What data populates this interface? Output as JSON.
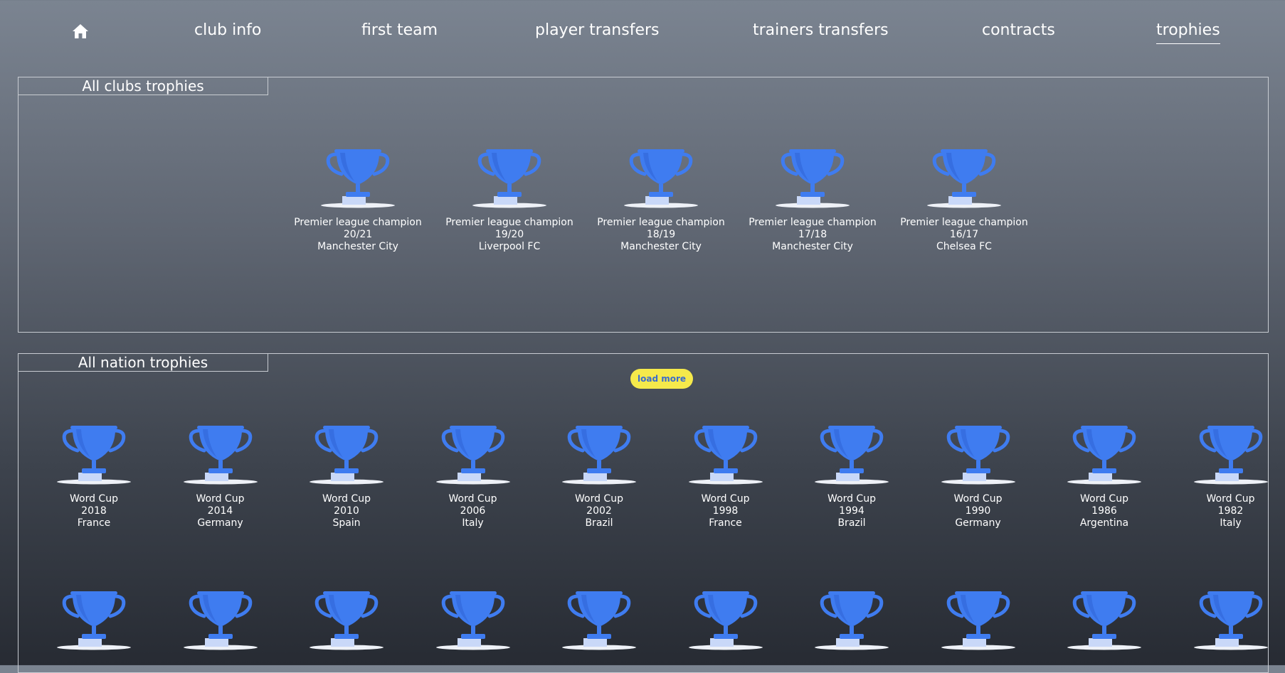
{
  "nav": {
    "items": [
      {
        "label": "club info"
      },
      {
        "label": "first team"
      },
      {
        "label": "player transfers"
      },
      {
        "label": "trainers transfers"
      },
      {
        "label": "contracts"
      },
      {
        "label": "trophies"
      }
    ],
    "active": "trophies"
  },
  "clubs": {
    "title": "All clubs trophies",
    "load_more": "load more",
    "trophies": [
      {
        "name": "Premier league champion",
        "season": "20/21",
        "winner": "Manchester City"
      },
      {
        "name": "Premier league champion",
        "season": "19/20",
        "winner": "Liverpool FC"
      },
      {
        "name": "Premier league champion",
        "season": "18/19",
        "winner": "Manchester City"
      },
      {
        "name": "Premier league champion",
        "season": "17/18",
        "winner": "Manchester City"
      },
      {
        "name": "Premier league champion",
        "season": "16/17",
        "winner": "Chelsea FC"
      }
    ]
  },
  "nations": {
    "title": "All nation trophies",
    "trophies": [
      {
        "name": "Word Cup",
        "year": "2018",
        "winner": "France"
      },
      {
        "name": "Word Cup",
        "year": "2014",
        "winner": "Germany"
      },
      {
        "name": "Word Cup",
        "year": "2010",
        "winner": "Spain"
      },
      {
        "name": "Word Cup",
        "year": "2006",
        "winner": "Italy"
      },
      {
        "name": "Word Cup",
        "year": "2002",
        "winner": "Brazil"
      },
      {
        "name": "Word Cup",
        "year": "1998",
        "winner": "France"
      },
      {
        "name": "Word Cup",
        "year": "1994",
        "winner": "Brazil"
      },
      {
        "name": "Word Cup",
        "year": "1990",
        "winner": "Germany"
      },
      {
        "name": "Word Cup",
        "year": "1986",
        "winner": "Argentina"
      },
      {
        "name": "Word Cup",
        "year": "1982",
        "winner": "Italy"
      }
    ],
    "second_row_count": 10
  },
  "colors": {
    "trophy": "#3f7cf0",
    "trophy_dark": "#2f62d6",
    "base": "#c9d8f8",
    "load_more_bg": "#f5e94b"
  },
  "icons": {
    "home": "home-icon",
    "trophy": "trophy-icon"
  }
}
